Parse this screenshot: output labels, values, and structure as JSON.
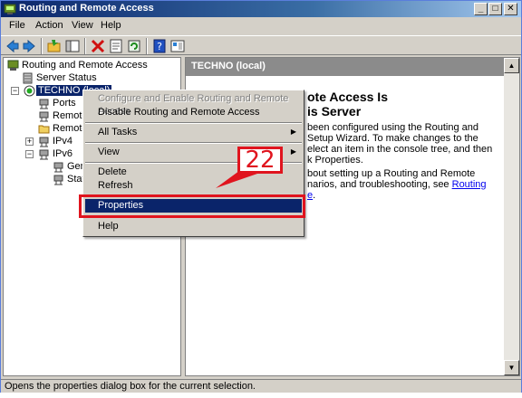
{
  "window": {
    "title": "Routing and Remote Access"
  },
  "menubar": [
    {
      "label": "File"
    },
    {
      "label": "Action"
    },
    {
      "label": "View"
    },
    {
      "label": "Help"
    }
  ],
  "tree": {
    "root": "Routing and Remote Access",
    "server_status": "Server Status",
    "server": "TECHNO (local)",
    "ports": "Ports",
    "remote1": "Remote",
    "remote2": "Remote",
    "ipv4": "IPv4",
    "ipv6": "IPv6",
    "gen": "Gene",
    "stat": "Stat"
  },
  "rightpane": {
    "header": "TECHNO (local)",
    "title_line1": "ote Access Is",
    "title_line2": "is Server",
    "para1_l1": "been configured using the Routing and",
    "para1_l2": "Setup Wizard. To make changes to the",
    "para1_l3": "elect an item in the console tree, and then",
    "para1_l4": "k Properties.",
    "para2_l1": "bout setting up a Routing and Remote",
    "para2_l2": "narios, and troubleshooting, see",
    "para2_link": "Routing",
    "para2_l3_link": "e",
    "para2_l3_rest": "."
  },
  "context_menu": {
    "configure": "Configure and Enable Routing and Remote Access",
    "disable": "Disable Routing and Remote Access",
    "all_tasks": "All Tasks",
    "view": "View",
    "delete": "Delete",
    "refresh": "Refresh",
    "properties": "Properties",
    "help": "Help"
  },
  "annotation": {
    "step_number": "22",
    "color": "#e0141e"
  },
  "statusbar": {
    "text": "Opens the properties dialog box for the current selection."
  },
  "colors": {
    "selection": "#0a246a",
    "titlebar": "#0a246a",
    "link": "#0000ee"
  }
}
